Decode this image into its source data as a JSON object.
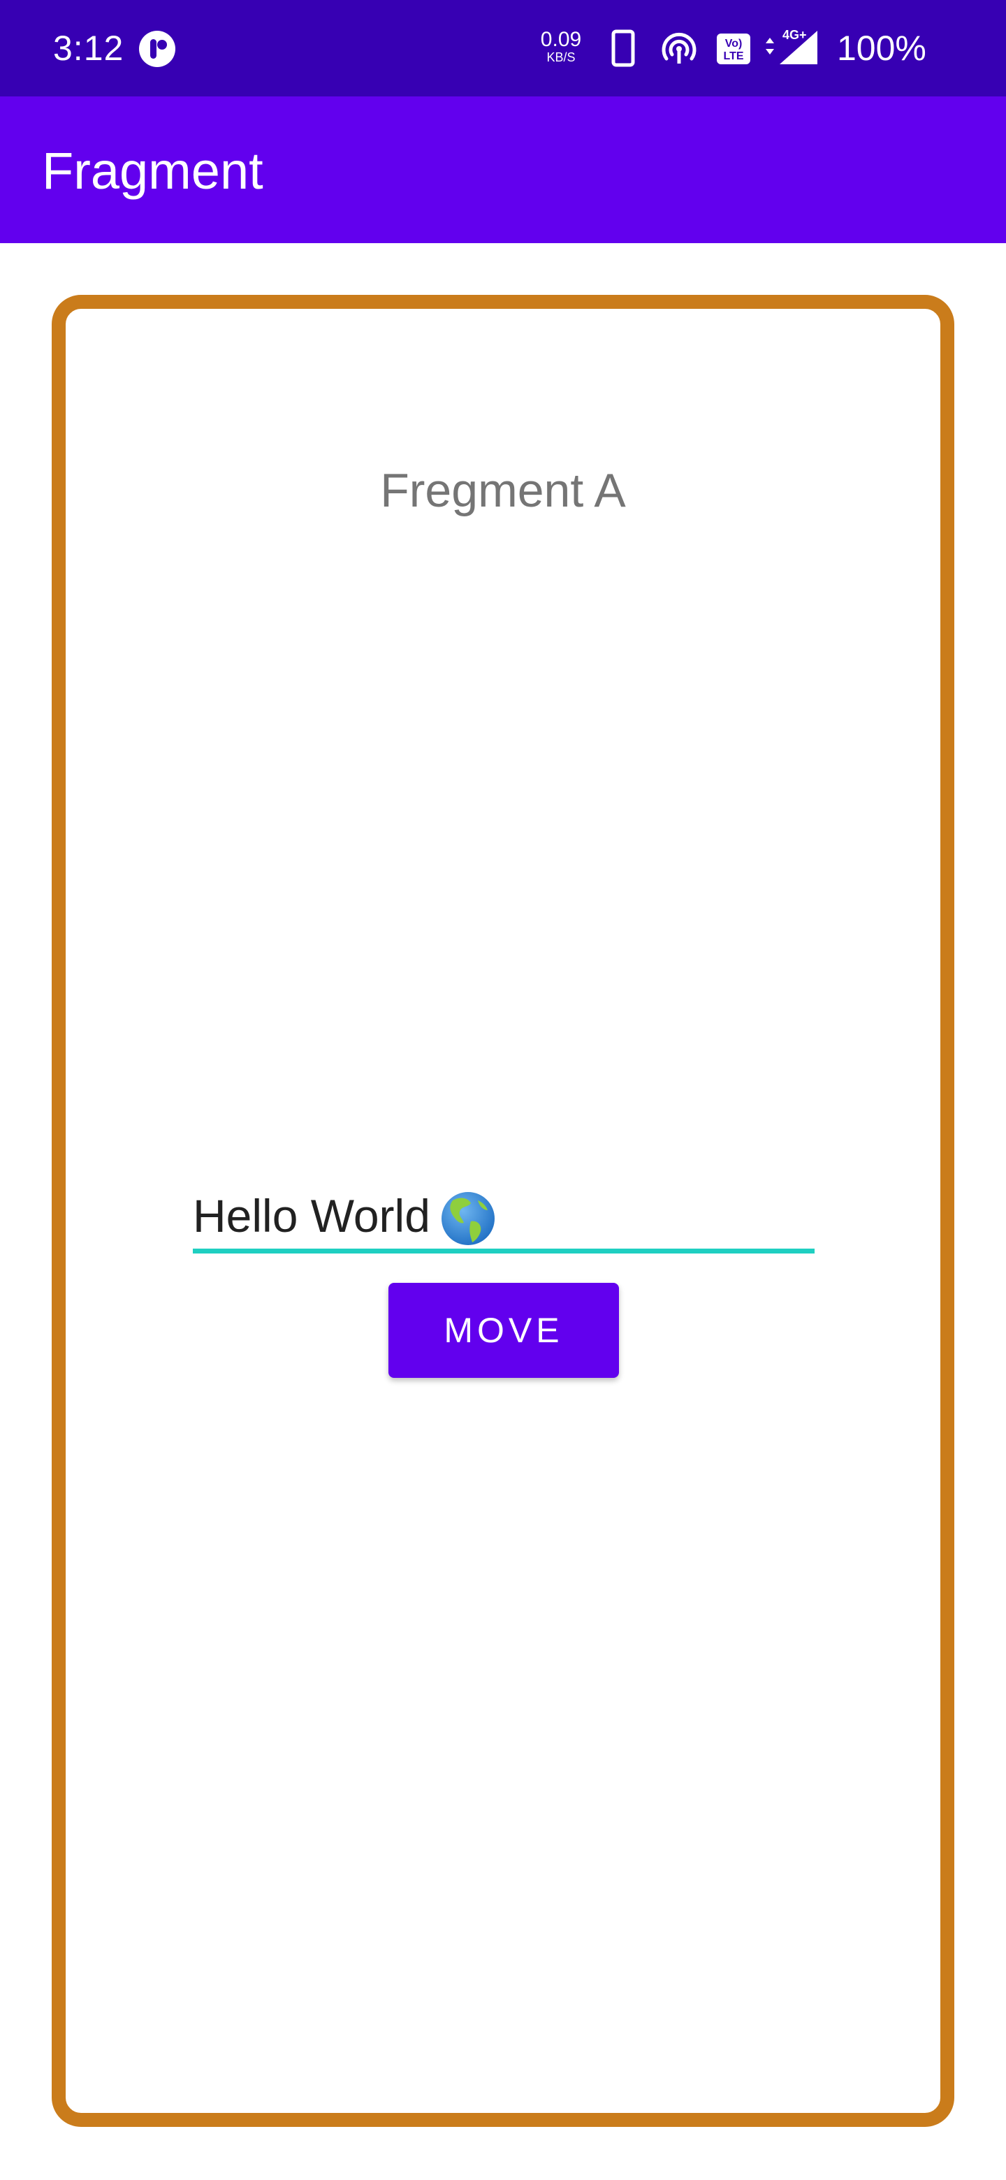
{
  "status_bar": {
    "time": "3:12",
    "net_speed_value": "0.09",
    "net_speed_unit": "KB/S",
    "battery_percent": "100%",
    "icons": [
      "app-notification-icon",
      "phone-icon",
      "hotspot-icon",
      "volte-icon",
      "signal-4g-icon"
    ],
    "color": "#3700b3"
  },
  "app_bar": {
    "title": "Fragment",
    "color": "#6200ee"
  },
  "fragment": {
    "title": "Fregment A",
    "border_color": "#ca7c1b",
    "input_value": "Hello World",
    "input_emoji": "globe-americas-icon",
    "underline_color": "#1fcfc1",
    "button_label": "MOVE"
  }
}
